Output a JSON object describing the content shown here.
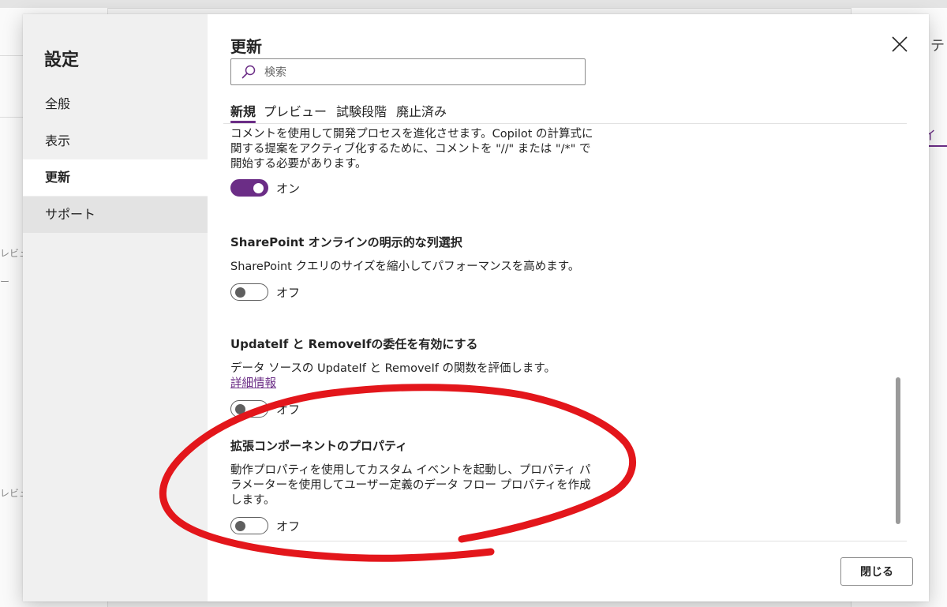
{
  "background": {
    "left_fragments": [
      "レビュ",
      "ー",
      "レビュ"
    ],
    "right_top_fragment": "テ",
    "right_tab_fragment": "イ"
  },
  "dialog": {
    "nav": {
      "title": "設定",
      "items": [
        {
          "label": "全般"
        },
        {
          "label": "表示"
        },
        {
          "label": "更新"
        },
        {
          "label": "サポート"
        }
      ],
      "selected": "更新"
    },
    "page_title": "更新",
    "search": {
      "placeholder": "検索",
      "value": ""
    },
    "tabs": [
      {
        "label": "新規",
        "active": true
      },
      {
        "label": "プレビュー"
      },
      {
        "label": "試験段階"
      },
      {
        "label": "廃止済み"
      }
    ],
    "settings": [
      {
        "title": "",
        "description": "コメントを使用して開発プロセスを進化させます。Copilot の計算式に関する提案をアクティブ化するために、コメントを \"//\" または \"/*\" で開始する必要があります。",
        "toggle_on": true,
        "toggle_label": "オン"
      },
      {
        "title": "SharePoint オンラインの明示的な列選択",
        "description": "SharePoint クエリのサイズを縮小してパフォーマンスを高めます。",
        "toggle_on": false,
        "toggle_label": "オフ"
      },
      {
        "title": "UpdateIf と RemoveIfの委任を有効にする",
        "description": "データ ソースの UpdateIf と RemoveIf の関数を評価します。",
        "link": "詳細情報",
        "toggle_on": false,
        "toggle_label": "オフ"
      },
      {
        "title": "拡張コンポーネントのプロパティ",
        "description": "動作プロパティを使用してカスタム イベントを起動し、プロパティ パラメーターを使用してユーザー定義のデータ フロー プロパティを作成します。",
        "toggle_on": false,
        "toggle_label": "オフ"
      }
    ],
    "close_button_label": "閉じる"
  },
  "colors": {
    "accent": "#6b2d86",
    "annotation": "#e3161b"
  },
  "icons": {
    "close": "close-icon",
    "search": "search-icon"
  }
}
